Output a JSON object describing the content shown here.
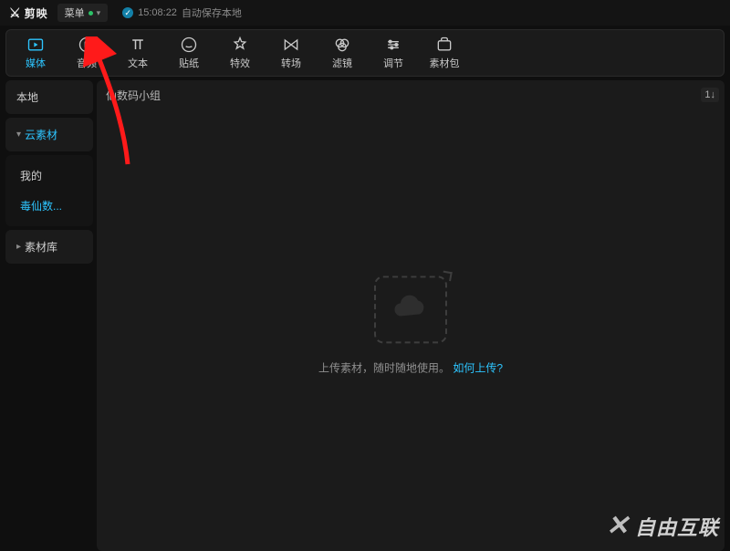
{
  "titlebar": {
    "app_name": "剪映",
    "menu_label": "菜单",
    "save_time": "15:08:22",
    "save_text": "自动保存本地"
  },
  "toolbar": [
    {
      "id": "media",
      "label": "媒体",
      "active": true
    },
    {
      "id": "audio",
      "label": "音频",
      "active": false
    },
    {
      "id": "text",
      "label": "文本",
      "active": false
    },
    {
      "id": "sticker",
      "label": "贴纸",
      "active": false
    },
    {
      "id": "effect",
      "label": "特效",
      "active": false
    },
    {
      "id": "transition",
      "label": "转场",
      "active": false
    },
    {
      "id": "filter",
      "label": "滤镜",
      "active": false
    },
    {
      "id": "adjust",
      "label": "调节",
      "active": false
    },
    {
      "id": "pack",
      "label": "素材包",
      "active": false
    }
  ],
  "sidebar": {
    "tabs": [
      {
        "id": "local",
        "label": "本地",
        "type": "plain"
      },
      {
        "id": "cloud",
        "label": "云素材",
        "type": "expanded",
        "current": true
      },
      {
        "id": "library",
        "label": "素材库",
        "type": "collapsed"
      }
    ],
    "cloud_items": [
      {
        "id": "mine",
        "label": "我的",
        "current": false
      },
      {
        "id": "team",
        "label": "毒仙数...",
        "current": true
      }
    ]
  },
  "content": {
    "breadcrumb": "仙数码小组",
    "right_chip": "1↓",
    "empty_hint_pre": "上传素材，随时随地使用。",
    "empty_hint_link": "如何上传?"
  },
  "watermark": "自由互联"
}
